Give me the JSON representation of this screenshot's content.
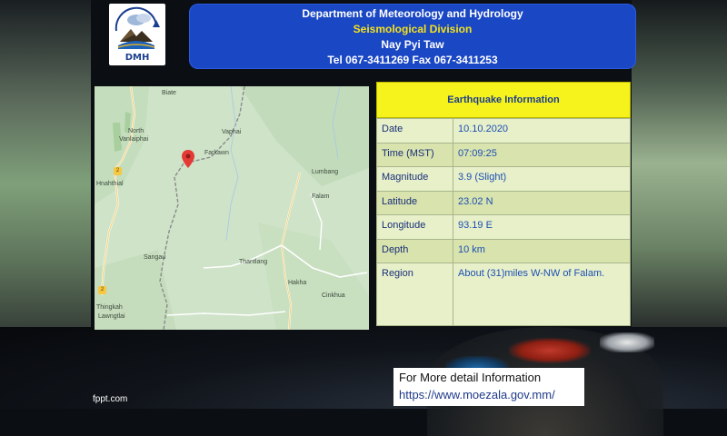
{
  "header": {
    "department": "Department of Meteorology and Hydrology",
    "division": "Seismological Division",
    "city": "Nay Pyi Taw",
    "contact": "Tel 067-3411269 Fax 067-3411253"
  },
  "logo": {
    "text": "DMH"
  },
  "map": {
    "labels": {
      "biate": "Biate",
      "north_vanlaiphai": "North",
      "north_vanlaiphai_2": "Vanlaiphai",
      "vaphai": "Vaphai",
      "farkawn": "Farkawn",
      "hnahthial": "Hnahthial",
      "lumbang": "Lumbang",
      "falam": "Falam",
      "sangau": "Sangau",
      "thantlang": "Thantlang",
      "hakha": "Hakha",
      "cinkhua": "Cinkhua",
      "thingkah": "Thingkah",
      "lawngtlai": "Lawngtlai"
    },
    "shields": {
      "s1": "2",
      "s2": "2"
    }
  },
  "info": {
    "title": "Earthquake  Information",
    "rows": [
      {
        "label": "Date",
        "value": "10.10.2020"
      },
      {
        "label": "Time (MST)",
        "value": "07:09:25"
      },
      {
        "label": "Magnitude",
        "value": "3.9  (Slight)"
      },
      {
        "label": "Latitude",
        "value": "23.02  N"
      },
      {
        "label": "Longitude",
        "value": "93.19  E"
      },
      {
        "label": "Depth",
        "value": "10  km"
      },
      {
        "label": "Region",
        "value": "About  (31)miles  W-NW of Falam."
      }
    ]
  },
  "footer": {
    "more_label": "For More detail Information",
    "url": "https://www.moezala.gov.mm/",
    "fppt": "fppt.com"
  },
  "colors": {
    "header_bg": "#1a47c4",
    "division_text": "#f5e21b",
    "info_title_bg": "#f6f31c",
    "table_text": "#1d4fb4",
    "pin": "#e53935"
  }
}
